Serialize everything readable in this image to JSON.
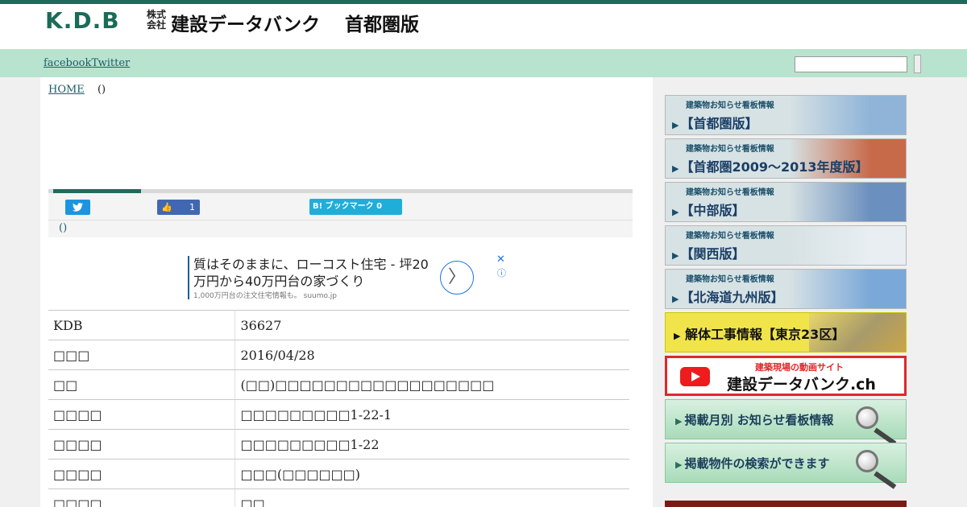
{
  "header": {
    "logo_mark": "K.D.B",
    "company_type": "株式会社",
    "company_name": "建設データバンク",
    "edition": "首都圏版"
  },
  "nav": {
    "facebook_label": "facebook",
    "twitter_label": "Twitter",
    "search_placeholder": ""
  },
  "breadcrumb": {
    "home": "HOME",
    "current": "()"
  },
  "share": {
    "facebook_count": "1",
    "hatena_label": "B! ブックマーク 0"
  },
  "sub_title": "()",
  "ad": {
    "headline": "質はそのままに、ローコスト住宅 - 坪20万円から40万円台の家づくり",
    "sub": "1,000万円台の注文住宅情報も。 suumo.jp",
    "arrow": "〉",
    "close": "✕",
    "info": "ⓘ"
  },
  "table": {
    "rows": [
      {
        "label": "KDB",
        "value": "36627"
      },
      {
        "label": "□□□",
        "value": "2016/04/28"
      },
      {
        "label": "□□",
        "value": "(□□)□□□□□□□□□□□□□□□□□□"
      },
      {
        "label": "□□□□",
        "value": "□□□□□□□□□1-22-1"
      },
      {
        "label": "□□□□",
        "value": "□□□□□□□□□1-22"
      },
      {
        "label": "□□□□",
        "value": "□□□(□□□□□□)"
      },
      {
        "label": "□□□□",
        "value": "□□"
      }
    ]
  },
  "sidebar": {
    "banners": [
      {
        "small": "建築物お知らせ看板情報",
        "big": "【首都圏版】",
        "pic_color": "#8fb4d8"
      },
      {
        "small": "建築物お知らせ看板情報",
        "big": "【首都圏2009〜2013年度版】",
        "pic_color": "#c76a4a"
      },
      {
        "small": "建築物お知らせ看板情報",
        "big": "【中部版】",
        "pic_color": "#6b8fbf"
      },
      {
        "small": "建築物お知らせ看板情報",
        "big": "【関西版】",
        "pic_color": "#e8eef2"
      },
      {
        "small": "建築物お知らせ看板情報",
        "big": "【北海道九州版】",
        "pic_color": "#7aa8d8"
      }
    ],
    "demolition": "解体工事情報【東京23区】",
    "channel_small": "建築現場の動画サイト",
    "channel_big": "建設データバンク.ch",
    "search_banners": [
      {
        "label": "掲載月別 お知らせ看板情報"
      },
      {
        "label": "掲載物件の検索ができます"
      }
    ]
  }
}
